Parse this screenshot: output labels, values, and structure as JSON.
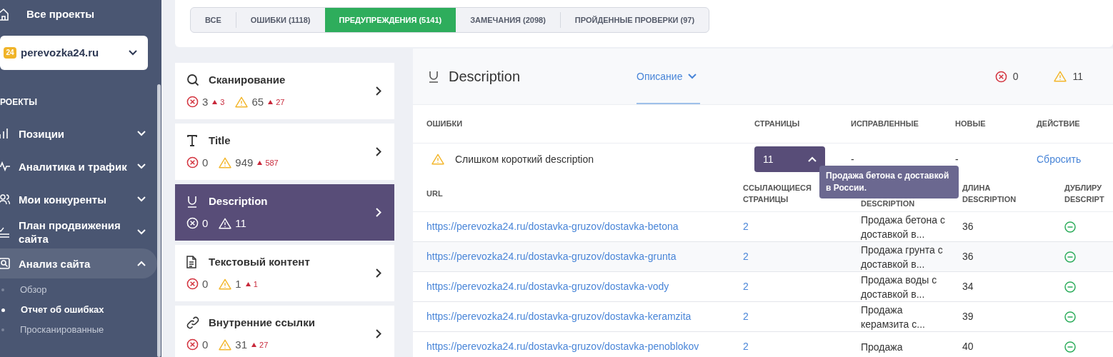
{
  "sidebar": {
    "all_projects": "Все проекты",
    "project": {
      "name": "perevozka24.ru",
      "logo": "24"
    },
    "section_title": "РОЕКТЫ",
    "items": [
      {
        "label": "Позиции",
        "expanded": false,
        "selected": false
      },
      {
        "label": "Аналитика и трафик",
        "expanded": false,
        "selected": false
      },
      {
        "label": "Мои конкуренты",
        "expanded": false,
        "selected": false
      },
      {
        "label": "План продвижения сайта",
        "expanded": false,
        "selected": false
      },
      {
        "label": "Анализ сайта",
        "expanded": true,
        "selected": true,
        "children": [
          {
            "label": "Обзор",
            "selected": false
          },
          {
            "label": "Отчет об ошибках",
            "selected": true
          },
          {
            "label": "Просканированные",
            "selected": false
          }
        ]
      }
    ]
  },
  "filter_tabs": [
    {
      "label": "ВСЕ",
      "selected": false
    },
    {
      "label": "ОШИБКИ (1118)",
      "selected": false
    },
    {
      "label": "ПРЕДУПРЕЖДЕНИЯ (5141)",
      "selected": true
    },
    {
      "label": "ЗАМЕЧАНИЯ (2098)",
      "selected": false
    },
    {
      "label": "ПРОЙДЕННЫЕ ПРОВЕРКИ (97)",
      "selected": false
    }
  ],
  "categories": [
    {
      "title": "Сканирование",
      "errors": "3",
      "errors_delta": "3",
      "warnings": "65",
      "warnings_delta": "27",
      "selected": false
    },
    {
      "title": "Title",
      "errors": "0",
      "warnings": "949",
      "warnings_delta": "587",
      "selected": false
    },
    {
      "title": "Description",
      "errors": "0",
      "warnings": "11",
      "selected": true
    },
    {
      "title": "Текстовый контент",
      "errors": "0",
      "warnings": "1",
      "warnings_delta": "1",
      "selected": false
    },
    {
      "title": "Внутренние ссылки",
      "errors": "0",
      "warnings": "31",
      "warnings_delta": "27",
      "selected": false
    }
  ],
  "detail": {
    "title": "Description",
    "tab": {
      "label": "Описание",
      "selected": true
    },
    "errors": "0",
    "warnings": "11",
    "issues_columns": [
      "ОШИБКИ",
      "СТРАНИЦЫ",
      "ИСПРАВЛЕННЫЕ",
      "НОВЫЕ",
      "ДЕЙСТВИЕ"
    ],
    "issues": [
      {
        "label": "Слишком короткий description",
        "pages": "11",
        "expanded": true,
        "fixed": "-",
        "new": "-",
        "action": "Сбросить"
      }
    ],
    "url_columns": [
      "URL",
      "ССЫЛАЮЩИЕСЯ СТРАНИЦЫ",
      "DESCRIPTION",
      "ДЛИНА DESCRIPTION",
      "ДУБЛИРУ DESCRIPT"
    ],
    "urls": [
      {
        "url": "https://perevozka24.ru/dostavka-gruzov/dostavka-betona",
        "links": "2",
        "description": "Продажа бетона с доставкой в...",
        "length": "36"
      },
      {
        "url": "https://perevozka24.ru/dostavka-gruzov/dostavka-grunta",
        "links": "2",
        "description": "Продажа грунта с доставкой в...",
        "length": "36"
      },
      {
        "url": "https://perevozka24.ru/dostavka-gruzov/dostavka-vody",
        "links": "2",
        "description": "Продажа воды с доставкой в...",
        "length": "34"
      },
      {
        "url": "https://perevozka24.ru/dostavka-gruzov/dostavka-keramzita",
        "links": "2",
        "description": "Продажа керамзита с...",
        "length": "39"
      },
      {
        "url": "https://perevozka24.ru/dostavka-gruzov/dostavka-penoblokov",
        "links": "2",
        "description": "Продажа",
        "length": "40"
      }
    ],
    "tooltip": "Продажа бетона с доставкой в России."
  }
}
